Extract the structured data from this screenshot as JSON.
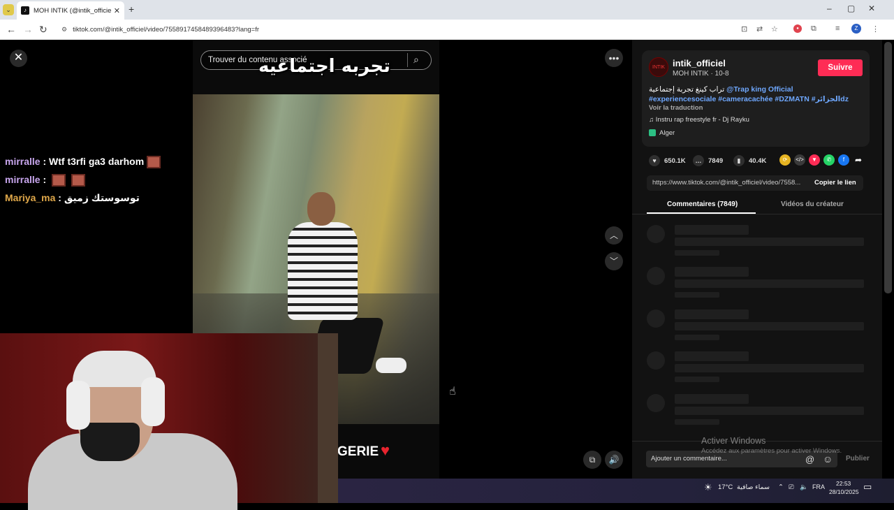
{
  "browser": {
    "tab_title": "MOH INTIK (@intik_officiel) | Ti",
    "url": "tiktok.com/@intik_officiel/video/7558917458489396483?lang=fr"
  },
  "video": {
    "search_placeholder": "Trouver du contenu associé",
    "overlay_text": "تجربه اجتماعيه",
    "bottom_text": "GERIE"
  },
  "chat": [
    {
      "user": "mirralle",
      "sep": " : ",
      "message": "Wtf t3rfi ga3 darhom"
    },
    {
      "user": "mirralle",
      "sep": " : ",
      "message": ""
    },
    {
      "user": "Mariya_ma",
      "sep": " : ",
      "message": "توسوستك زميق"
    }
  ],
  "post": {
    "username": "intik_officiel",
    "subtitle": "MOH INTIK · 10-8",
    "follow_label": "Suivre",
    "desc_text": "تراب كينغ تجربة إجتماعية",
    "desc_tag1": "@Trap king Official",
    "desc_tag2": "#experiencesociale",
    "desc_tag3": "#cameracachée",
    "desc_tag4": "#DZMATN",
    "desc_tag5": "#الجزائرdz",
    "translate_label": "Voir la traduction",
    "music": "Instru rap freestyle fr - Dj Rayku",
    "location": "Alger",
    "likes": "650.1K",
    "comments": "7849",
    "saves": "40.4K",
    "link": "https://www.tiktok.com/@intik_officiel/video/7558...",
    "copy_label": "Copier le lien",
    "tab_comments": "Commentaires (7849)",
    "tab_creator": "Vidéos du créateur",
    "comment_placeholder": "Ajouter un commentaire...",
    "publish_label": "Publier"
  },
  "watermark": {
    "line1": "Activer Windows",
    "line2": "Accédez aux paramètres pour activer Windows."
  },
  "taskbar": {
    "temp": "17°C",
    "weather": "سماء صافية",
    "lang": "FRA",
    "time": "22:53",
    "date": "28/10/2025"
  }
}
